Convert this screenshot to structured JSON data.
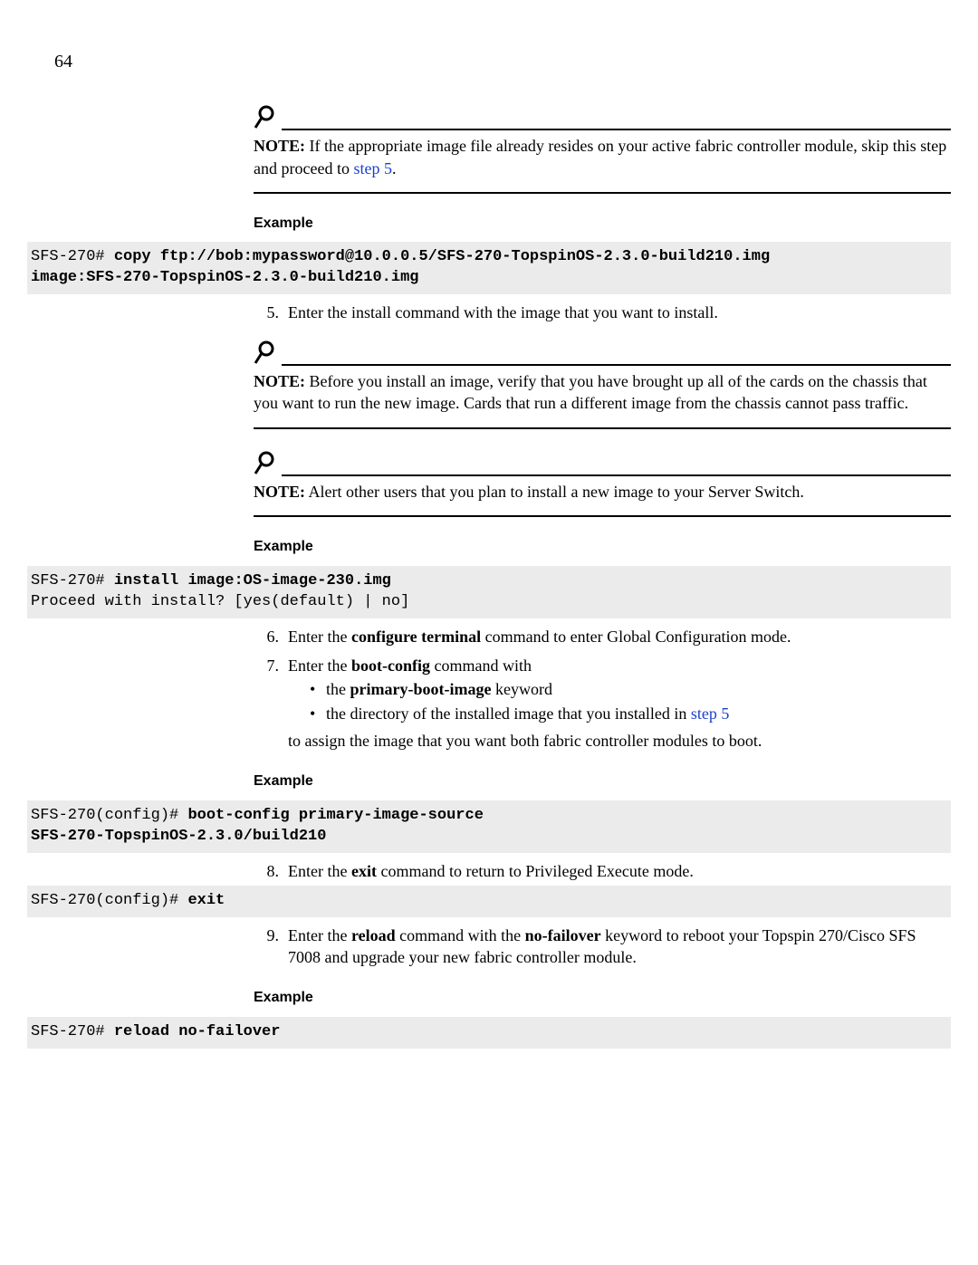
{
  "page_number": "64",
  "note1": {
    "label": "NOTE:",
    "text_before_link": "  If the appropriate image file already resides on your active fabric controller module, skip this step and proceed to ",
    "link": "step 5",
    "text_after_link": "."
  },
  "example_label": "Example",
  "code1": {
    "prompt": "SFS-270# ",
    "cmd_line1": "copy ftp://bob:mypassword@10.0.0.5/SFS-270-TopspinOS-2.3.0-build210.img",
    "cmd_line2": "image:SFS-270-TopspinOS-2.3.0-build210.img"
  },
  "step5": {
    "num": "5.",
    "text": "Enter the install command with the image that you want to install."
  },
  "note2": {
    "label": "NOTE:",
    "text": "  Before you install an image, verify that you have brought up all of the cards on the chassis that you want to run the new image. Cards that run a different image from the chassis cannot pass traffic."
  },
  "note3": {
    "label": "NOTE:",
    "text": "  Alert other users that you plan to install a new image to your Server Switch."
  },
  "code2": {
    "prompt": "SFS-270# ",
    "cmd": "install image:OS-image-230.img",
    "output": "Proceed with install? [yes(default) | no]"
  },
  "step6": {
    "num": "6.",
    "prefix": "Enter the ",
    "bold": "configure terminal",
    "suffix": " command to enter Global Configuration mode."
  },
  "step7": {
    "num": "7.",
    "prefix": "Enter the ",
    "bold": "boot-config",
    "suffix": " command with",
    "bullet1_prefix": "the ",
    "bullet1_bold": "primary-boot-image",
    "bullet1_suffix": " keyword",
    "bullet2_prefix": "the directory of the installed image that you installed in ",
    "bullet2_link": "step 5",
    "continue": "to assign the image that you want both fabric controller modules to boot."
  },
  "code3": {
    "prompt": "SFS-270(config)# ",
    "cmd_line1": "boot-config primary-image-source",
    "cmd_line2": "SFS-270-TopspinOS-2.3.0/build210"
  },
  "step8": {
    "num": "8.",
    "prefix": "Enter the ",
    "bold": "exit",
    "suffix": " command to return to Privileged Execute mode."
  },
  "code4": {
    "prompt": "SFS-270(config)# ",
    "cmd": "exit"
  },
  "step9": {
    "num": "9.",
    "prefix": "Enter the ",
    "bold1": "reload",
    "mid1": " command with the ",
    "bold2": "no-failover",
    "suffix": " keyword to reboot your Topspin 270/Cisco SFS 7008 and upgrade your new fabric controller module."
  },
  "code5": {
    "prompt": "SFS-270# ",
    "cmd": "reload no-failover"
  }
}
